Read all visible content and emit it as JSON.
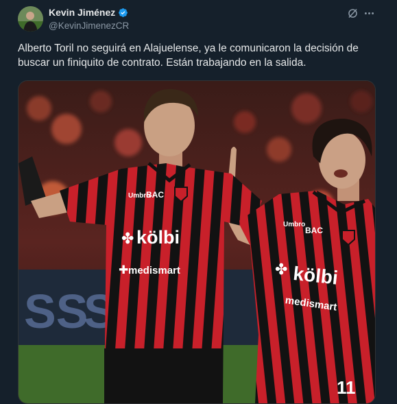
{
  "author": {
    "display_name": "Kevin Jiménez",
    "handle": "@KevinJimenezCR",
    "verified": true,
    "verified_color": "#1d9bf0"
  },
  "actions": {
    "grok_icon": "grok-icon",
    "more_icon": "more-icon"
  },
  "tweet": {
    "text": "Alberto Toril no seguirá en Alajuelense, ya le comunicaron la decisión de buscar un finiquito de contrato. Están trabajando en la salida."
  },
  "media": {
    "jersey_brand": "BAC",
    "sponsor_main": "kölbi",
    "sponsor_secondary": "medismart",
    "player_number": "11",
    "colors": {
      "jersey_red": "#c8202a",
      "jersey_black": "#121212",
      "pitch_green": "#3f6b2a",
      "background": "#15202b"
    }
  }
}
